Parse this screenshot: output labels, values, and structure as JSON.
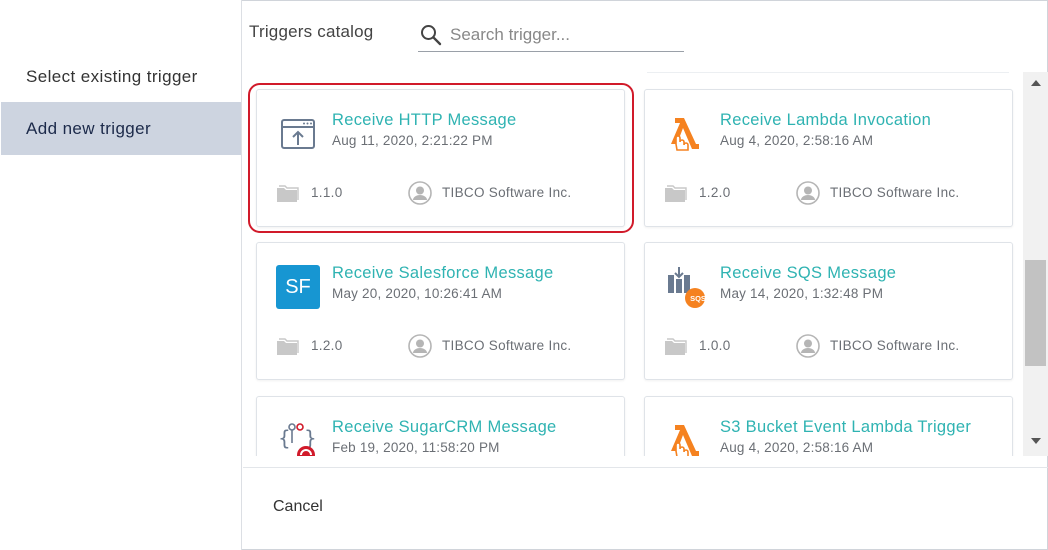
{
  "sidebar": {
    "items": [
      {
        "label": "Select existing trigger"
      },
      {
        "label": "Add new trigger"
      }
    ]
  },
  "header": {
    "title": "Triggers catalog",
    "search_placeholder": "Search trigger..."
  },
  "cards": [
    {
      "title": "Receive HTTP Message",
      "date": "Aug 11, 2020, 2:21:22 PM",
      "version": "1.1.0",
      "vendor": "TIBCO Software Inc.",
      "icon": "http-window-icon",
      "highlighted": true
    },
    {
      "title": "Receive Lambda Invocation",
      "date": "Aug 4, 2020, 2:58:16 AM",
      "version": "1.2.0",
      "vendor": "TIBCO Software Inc.",
      "icon": "lambda-icon"
    },
    {
      "title": "Receive Salesforce Message",
      "date": "May 20, 2020, 10:26:41 AM",
      "version": "1.2.0",
      "vendor": "TIBCO Software Inc.",
      "icon": "salesforce-icon",
      "icon_text": "SF"
    },
    {
      "title": "Receive SQS Message",
      "date": "May 14, 2020, 1:32:48 PM",
      "version": "1.0.0",
      "vendor": "TIBCO Software Inc.",
      "icon": "sqs-icon",
      "icon_text": "SQS"
    },
    {
      "title": "Receive SugarCRM Message",
      "date": "Feb 19, 2020, 11:58:20 PM",
      "icon": "sugarcrm-icon"
    },
    {
      "title": "S3 Bucket Event Lambda Trigger",
      "date": "Aug 4, 2020, 2:58:16 AM",
      "icon": "lambda-icon"
    }
  ],
  "footer": {
    "cancel_label": "Cancel"
  },
  "colors": {
    "accent": "#2fb3b2",
    "highlight": "#d11a2a",
    "sidebar_active": "#cdd4e0",
    "lambda_orange": "#f58220",
    "salesforce_blue": "#1796d2"
  }
}
